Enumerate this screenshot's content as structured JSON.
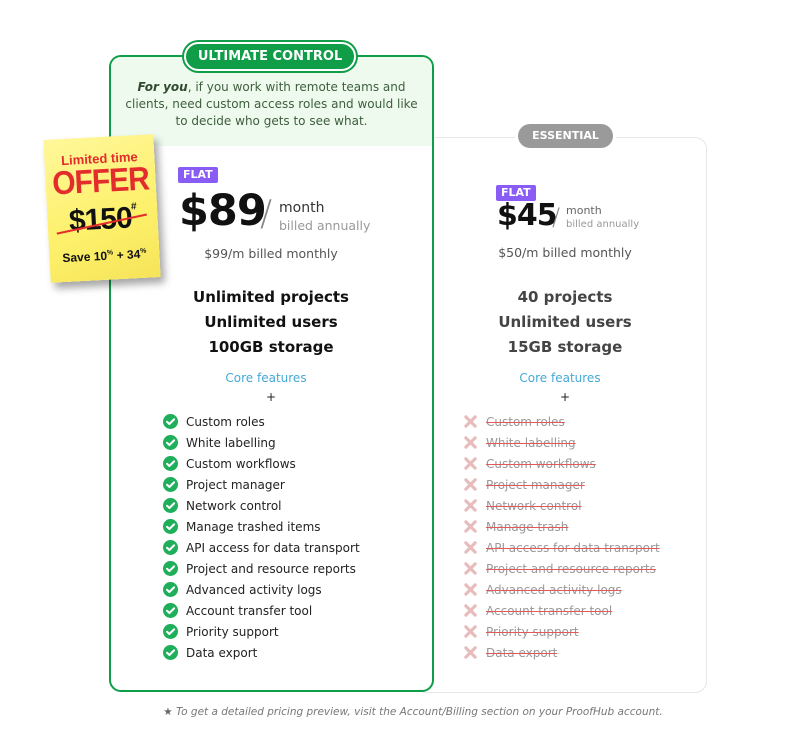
{
  "plans": {
    "ultimate": {
      "badge": "ULTIMATE CONTROL",
      "intro_bold": "For you",
      "intro_rest": ", if you work with remote teams and clients, need custom access roles and would like to decide who gets to see what.",
      "flat_label": "FLAT",
      "price": "$89",
      "slash": "/",
      "period": "month",
      "billing": "billed annually",
      "monthly_price": "$99/m billed monthly",
      "highlights": [
        "Unlimited projects",
        "Unlimited users",
        "100GB storage"
      ],
      "core_label": "Core features",
      "plus": "+",
      "features": [
        {
          "label": "Custom roles",
          "included": true
        },
        {
          "label": "White labelling",
          "included": true
        },
        {
          "label": "Custom workflows",
          "included": true
        },
        {
          "label": "Project manager",
          "included": true
        },
        {
          "label": "Network control",
          "included": true
        },
        {
          "label": "Manage trashed items",
          "included": true
        },
        {
          "label": "API access for data transport",
          "included": true
        },
        {
          "label": "Project and resource reports",
          "included": true
        },
        {
          "label": "Advanced activity logs",
          "included": true
        },
        {
          "label": "Account transfer tool",
          "included": true
        },
        {
          "label": "Priority support",
          "included": true
        },
        {
          "label": "Data export",
          "included": true
        }
      ]
    },
    "essential": {
      "badge": "ESSENTIAL",
      "flat_label": "FLAT",
      "price": "$45",
      "slash": "/",
      "period": "month",
      "billing": "billed annually",
      "monthly_price": "$50/m billed monthly",
      "highlights": [
        "40 projects",
        "Unlimited users",
        "15GB storage"
      ],
      "core_label": "Core features",
      "plus": "+",
      "features": [
        {
          "label": "Custom roles",
          "included": false
        },
        {
          "label": "White labelling",
          "included": false
        },
        {
          "label": "Custom workflows",
          "included": false
        },
        {
          "label": "Project manager",
          "included": false
        },
        {
          "label": "Network control",
          "included": false
        },
        {
          "label": "Manage trash",
          "included": false
        },
        {
          "label": "API access for data transport",
          "included": false
        },
        {
          "label": "Project and resource reports",
          "included": false
        },
        {
          "label": "Advanced activity logs",
          "included": false
        },
        {
          "label": "Account transfer tool",
          "included": false
        },
        {
          "label": "Priority support",
          "included": false
        },
        {
          "label": "Data export",
          "included": false
        }
      ]
    }
  },
  "offer": {
    "line1": "Limited time",
    "line2": "OFFER",
    "old_price": "$150",
    "old_price_mark": "#",
    "save_prefix": "Save 10",
    "save_pct1": "%",
    "save_mid": " + 34",
    "save_pct2": "%"
  },
  "footnote": {
    "icon": "star-icon",
    "text": "To get a detailed pricing preview, visit the Account/Billing section on your ProofHub account."
  },
  "colors": {
    "ultimate_green": "#0f9d48",
    "flat_purple": "#8a5cf6",
    "essential_gray": "#9a9a9a",
    "core_link_blue": "#45a8d6",
    "excluded_strike_red": "#e05a5a"
  }
}
